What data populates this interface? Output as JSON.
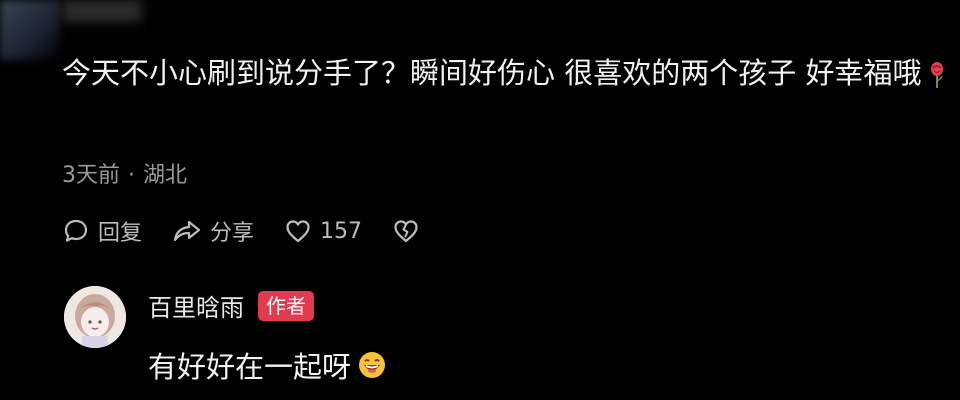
{
  "comment": {
    "text": "今天不小心刷到说分手了？瞬间好伤心 很喜欢的两个孩子 好幸福哦",
    "emoji": "rose-icon",
    "time": "3天前",
    "separator": "·",
    "location": "湖北"
  },
  "actions": {
    "reply_label": "回复",
    "share_label": "分享",
    "like_count": "157"
  },
  "reply": {
    "author_name": "百里晗雨",
    "author_badge": "作者",
    "text": "有好好在一起呀",
    "emoji": "grinning-face-icon"
  },
  "colors": {
    "background": "#000000",
    "text": "#f2f2f2",
    "meta": "#9a9a9a",
    "badge": "#e23a4f"
  }
}
